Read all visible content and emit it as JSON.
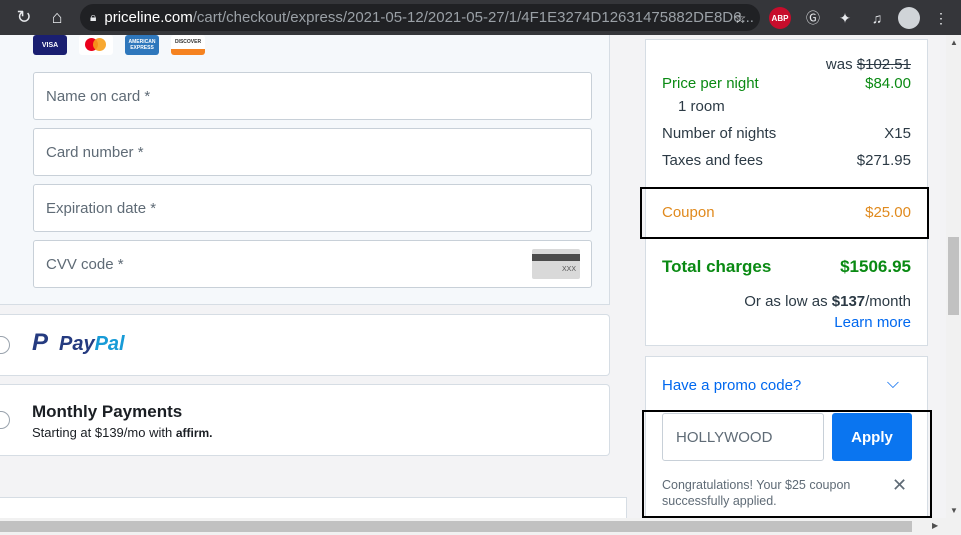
{
  "browser": {
    "url_domain": "priceline.com",
    "url_path": "/cart/checkout/express/2021-05-12/2021-05-27/1/4F1E3274D12631475882DE8D6...",
    "ext_abp": "ABP"
  },
  "card_logos": [
    "VISA",
    "",
    "AMERICAN EXPRESS",
    "DISCOVER"
  ],
  "card_form": {
    "name_placeholder": "Name on card *",
    "number_placeholder": "Card number *",
    "expiry_placeholder": "Expiration date *",
    "cvv_placeholder": "CVV code *",
    "cvv_card_text": "XXX"
  },
  "paypal": {
    "p": "P",
    "pay": "Pay",
    "pal": "Pal"
  },
  "monthly": {
    "title": "Monthly Payments",
    "subtitle_prefix": "Starting at $139/mo with",
    "affirm": "affirm."
  },
  "summary": {
    "was_label": "was",
    "was_price": "$102.51",
    "price_per_night_label": "Price per night",
    "price_per_night_value": "$84.00",
    "rooms": "1 room",
    "nights_label": "Number of nights",
    "nights_value": "X15",
    "taxes_label": "Taxes and fees",
    "taxes_value": "$271.95",
    "coupon_label": "Coupon",
    "coupon_value": "$25.00",
    "total_label": "Total charges",
    "total_value": "$1506.95",
    "aslow_prefix": "Or as low as",
    "aslow_amount": "$137",
    "aslow_suffix": "/month",
    "learn_more": "Learn more"
  },
  "promo": {
    "header": "Have a promo code?",
    "code_value": "HOLLYWOOD",
    "apply_label": "Apply",
    "message": "Congratulations! Your $25 coupon successfully applied."
  },
  "colors": {
    "accent_blue": "#0068ef",
    "apply_blue": "#0a75f0",
    "total_green": "#0a8a13",
    "coupon_orange": "#e08a1e"
  }
}
